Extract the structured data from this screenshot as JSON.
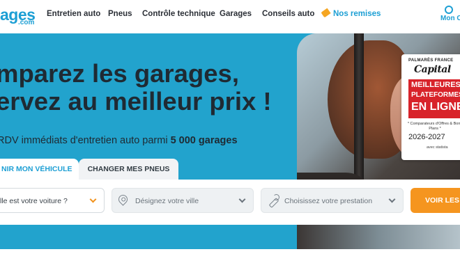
{
  "header": {
    "logo_main": "ages",
    "logo_sub": ".com",
    "nav": [
      {
        "label": "Entretien auto"
      },
      {
        "label": "Pneus"
      },
      {
        "label": "Contrôle technique"
      },
      {
        "label": "Garages"
      },
      {
        "label": "Conseils auto"
      },
      {
        "label": "Nos remises",
        "icon": "tag-icon"
      }
    ],
    "account_label": "Mon C"
  },
  "hero": {
    "title_line1": "mparez les garages,",
    "title_line2": "ervez au meilleur prix !",
    "subtitle_prefix": "RDV immédiats d'entretien auto parmi ",
    "subtitle_bold": "5 000 garages"
  },
  "badge": {
    "top": "PALMARÈS FRANCE",
    "brand": "Capital",
    "line1": "MEILLEURES",
    "line2": "PLATEFORMES",
    "line3": "EN LIGNE",
    "category": "* Comparateurs d'Offres & Bons Plans *",
    "years": "2026-2027",
    "partner": "avec statista"
  },
  "tabs": {
    "active": "NIR MON VÉHICULE",
    "inactive": "CHANGER MES PNEUS"
  },
  "search": {
    "car_placeholder": "lle est votre voiture ?",
    "city_placeholder": "Désignez votre ville",
    "service_placeholder": "Choisissez votre prestation",
    "submit_label": "VOIR LES T"
  },
  "colors": {
    "brand_blue": "#1d9fd4",
    "hero_blue": "#22a3cd",
    "cta_orange": "#f5951f",
    "badge_red": "#d8232a"
  }
}
